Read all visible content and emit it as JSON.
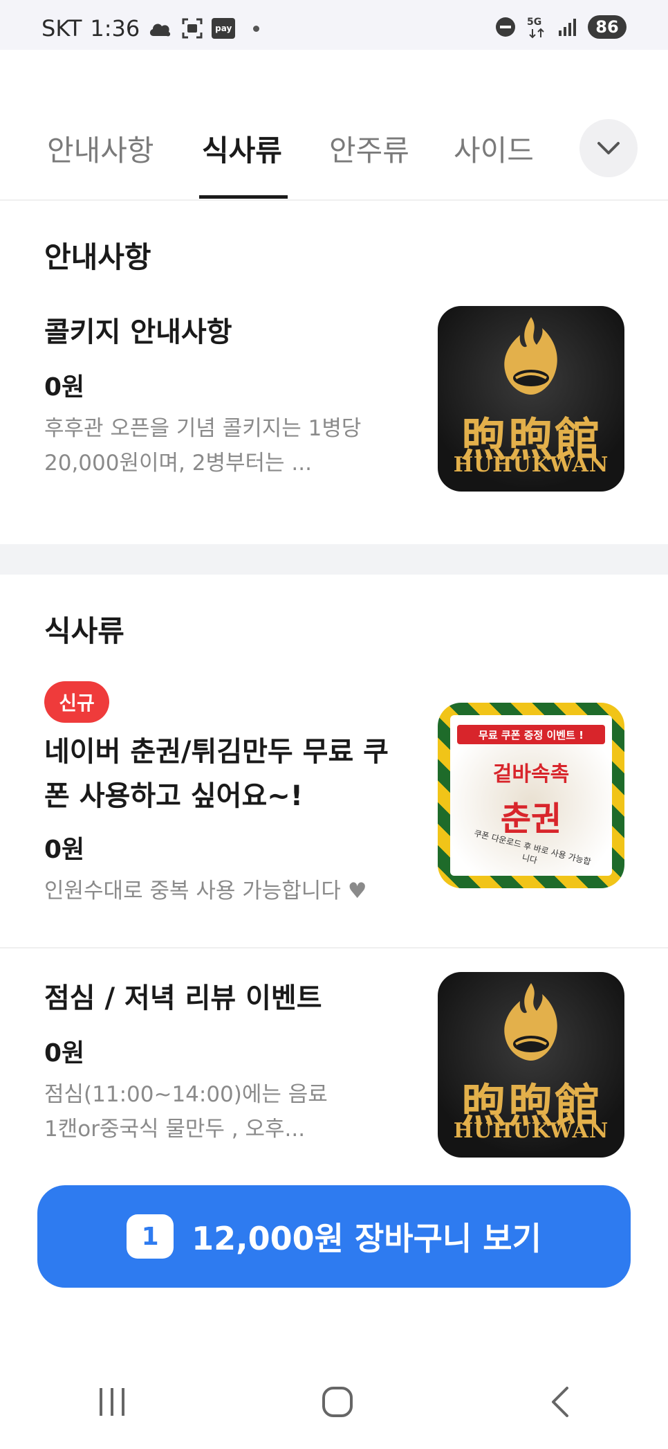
{
  "status_bar": {
    "carrier": "SKT",
    "time": "1:36",
    "pay_label": "pay",
    "network": "5G",
    "battery": "86"
  },
  "tabs": [
    {
      "label": "안내사항",
      "active": false
    },
    {
      "label": "식사류",
      "active": true
    },
    {
      "label": "안주류",
      "active": false
    },
    {
      "label": "사이드",
      "active": false
    }
  ],
  "tab_more_icon": "chevron-down-icon",
  "sections": [
    {
      "title": "안내사항",
      "items": [
        {
          "name": "콜키지 안내사항",
          "price": "0원",
          "desc_lines": [
            "후후관 오픈을 기념 콜키지는 1병당",
            "20,000원이며, 2병부터는 ..."
          ],
          "image": {
            "type": "logo",
            "text": "煦煦館",
            "sub": "HUHUKWAN"
          }
        }
      ]
    },
    {
      "title": "식사류",
      "items": [
        {
          "badge": "신규",
          "name_lines": [
            "네이버 춘권/튀김만두 무료 쿠",
            "폰 사용하고 싶어요~!"
          ],
          "price": "0원",
          "desc_lines": [
            "인원수대로 중복 사용 가능합니다 ♥"
          ],
          "image": {
            "type": "coupon",
            "banner": "무료 쿠폰 증정 이벤트 !",
            "line1": "겉바속촉",
            "line2": "춘권",
            "arc": "쿠폰 다운로드 후 바로 사용 가능합니다"
          }
        },
        {
          "name": "점심 / 저녁 리뷰 이벤트",
          "price": "0원",
          "desc_lines": [
            "점심(11:00~14:00)에는 음료",
            "1캔or중국식 물만두 , 오후..."
          ],
          "image": {
            "type": "logo",
            "text": "煦煦館",
            "sub": "HUHUKWAN"
          }
        }
      ]
    }
  ],
  "cart": {
    "count": "1",
    "label": "12,000원 장바구니 보기"
  },
  "colors": {
    "accent": "#2e7bf0",
    "badge": "#ef3b3b",
    "logo_gold": "#e3b04b"
  }
}
